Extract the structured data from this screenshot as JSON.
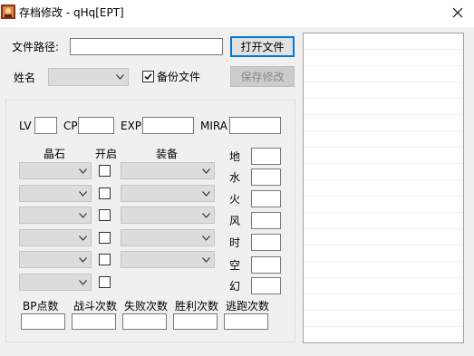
{
  "window": {
    "title": "存档修改 - qHq[EPT]"
  },
  "file": {
    "path_label": "文件路径:",
    "path_value": "",
    "open_button": "打开文件"
  },
  "name": {
    "label": "姓名",
    "selected": "",
    "backup_label": "备份文件",
    "backup_checked": true,
    "save_button": "保存修改"
  },
  "stats": {
    "lv_label": "LV",
    "lv_value": "",
    "cp_label": "CP",
    "cp_value": "",
    "exp_label": "EXP",
    "exp_value": "",
    "mira_label": "MIRA",
    "mira_value": ""
  },
  "columns": {
    "crystal": "晶石",
    "open": "开启",
    "equip": "装备"
  },
  "elements": [
    "地",
    "水",
    "火",
    "风",
    "时",
    "空",
    "幻"
  ],
  "bottom_stats": [
    "BP点数",
    "战斗次数",
    "失败次数",
    "胜利次数",
    "逃跑次数"
  ],
  "colors": {
    "titlebar_bg": "#ffffff",
    "window_bg": "#f0f0f0",
    "default_button_border": "#0078d7",
    "disabled_text": "#8a8a8a"
  },
  "icons": {
    "app": "app-icon",
    "close": "close-icon",
    "dropdown": "chevron-down-icon"
  }
}
